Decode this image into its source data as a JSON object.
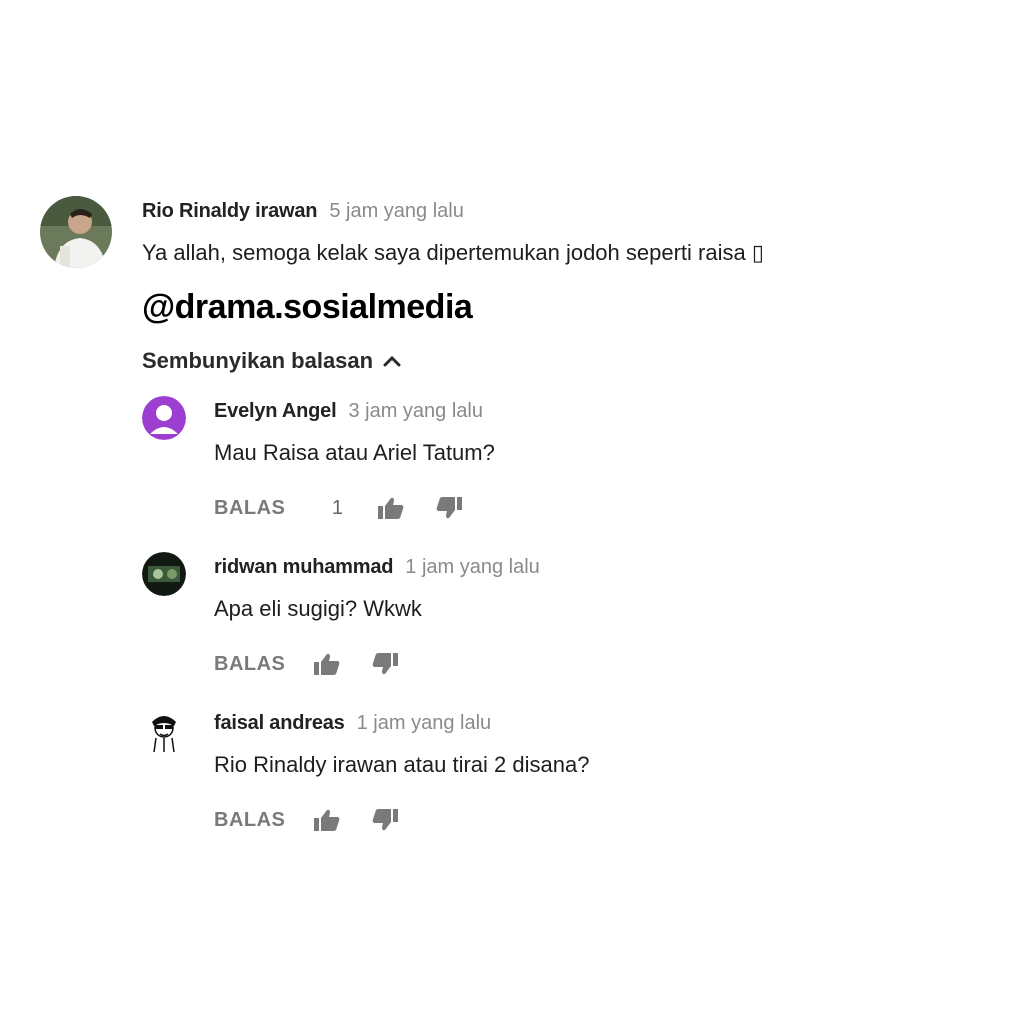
{
  "main_comment": {
    "author": "Rio Rinaldy irawan",
    "time": "5 jam yang lalu",
    "text": "Ya allah, semoga kelak saya dipertemukan jodoh seperti raisa ▯"
  },
  "watermark": "@drama.sosialmedia",
  "hide_replies_label": "Sembunyikan balasan",
  "replies": [
    {
      "author": "Evelyn Angel",
      "time": "3 jam yang lalu",
      "text": "Mau Raisa atau Ariel Tatum?",
      "reply_label": "BALAS",
      "like_count": "1"
    },
    {
      "author": "ridwan muhammad",
      "time": "1 jam yang lalu",
      "text": "Apa eli sugigi? Wkwk",
      "reply_label": "BALAS"
    },
    {
      "author": "faisal andreas",
      "time": "1 jam yang lalu",
      "text": "Rio Rinaldy irawan atau tirai 2 disana?",
      "reply_label": "BALAS"
    }
  ],
  "colors": {
    "default_avatar_purple": "#9c3fd0",
    "meta_gray": "#8a8a8a"
  }
}
